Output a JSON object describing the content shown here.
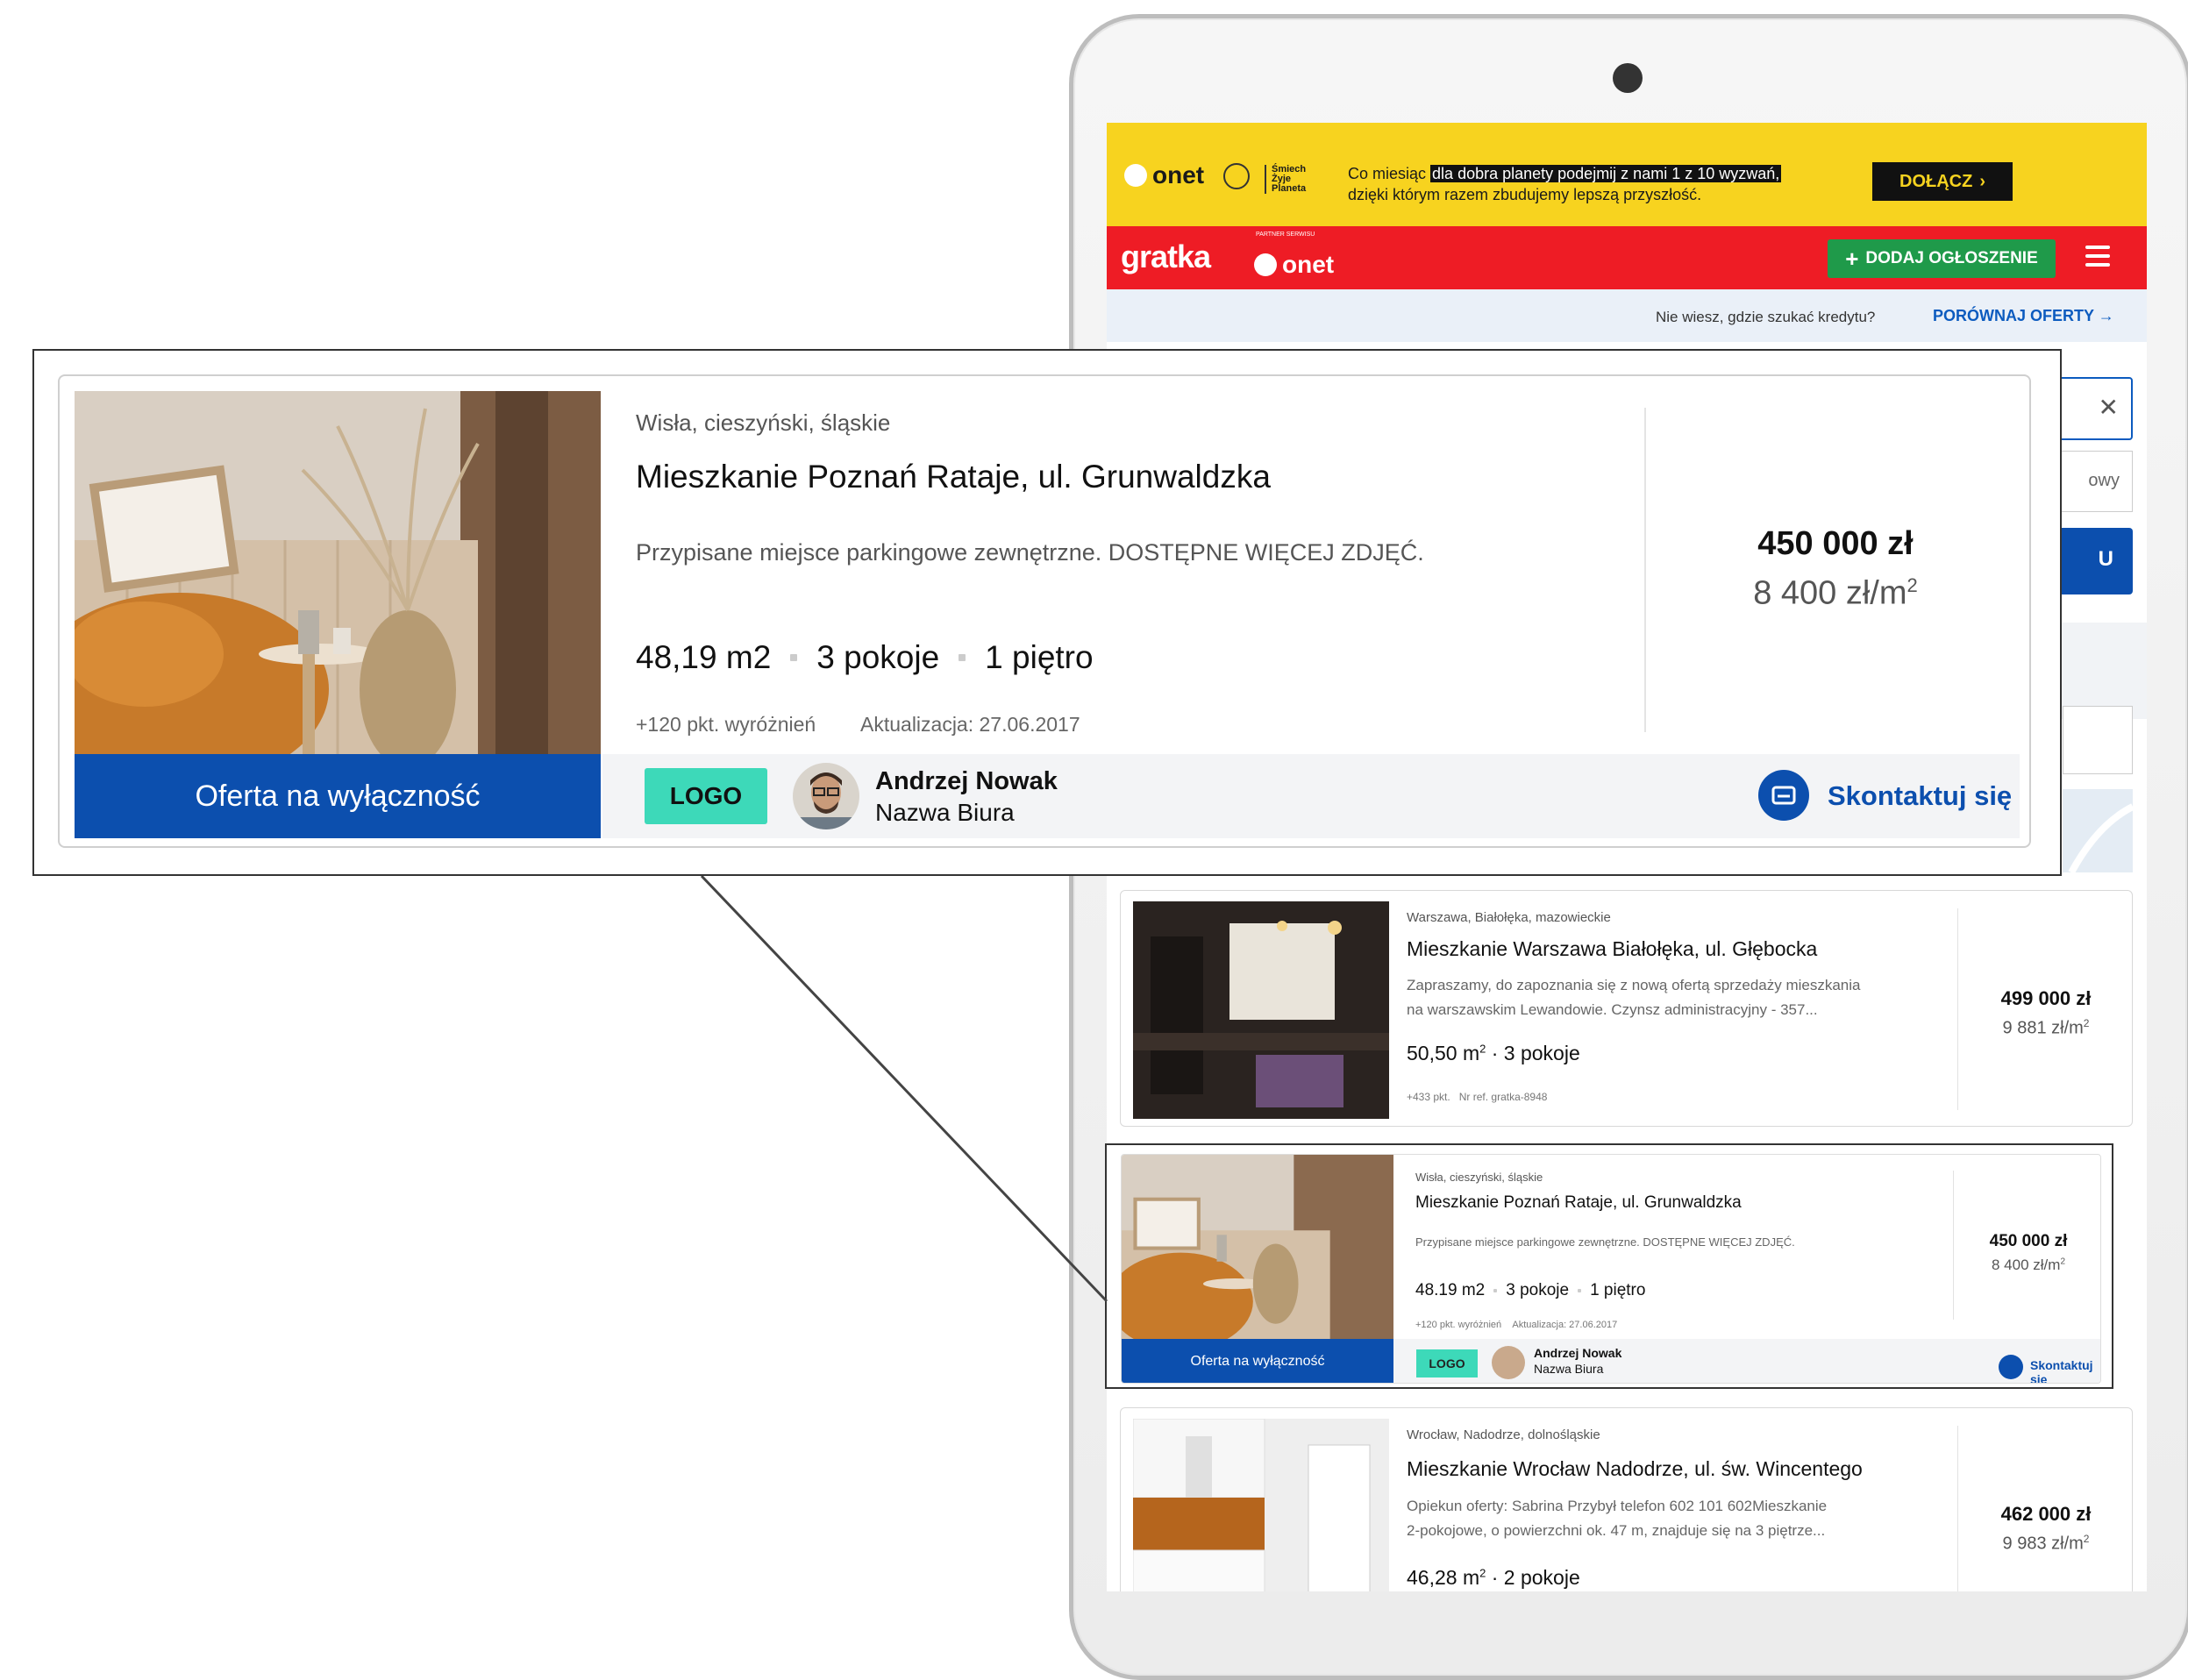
{
  "promo": {
    "brand": "onet",
    "campaign_logo": "Śmiech Żyje Planeta",
    "text_prefix": "Co miesiąc",
    "text_highlight": "dla dobra planety podejmij z nami 1 z 10 wyzwań,",
    "text_suffix": "dzięki którym razem zbudujemy lepszą przyszłość.",
    "cta": "DOŁĄCZ",
    "cta_icon": "chevron-right-icon"
  },
  "nav": {
    "logo": "gratka",
    "partner_caption": "PARTNER SERWISU",
    "partner_brand": "onet",
    "add_button": "DODAJ OGŁOSZENIE",
    "add_icon": "plus-icon",
    "menu_icon": "hamburger-icon"
  },
  "credit": {
    "question": "Nie wiesz, gdzie szukać kredytu?",
    "compare_link": "PORÓWNAJ OFERTY",
    "link_icon": "arrow-right-icon"
  },
  "search": {
    "clear_icon": "close-icon",
    "select_partial": "owy",
    "button_partial": "U"
  },
  "listings": [
    {
      "location": "Warszawa, Białołęka, mazowieckie",
      "title": "Mieszkanie Warszawa Białołęka, ul. Głębocka",
      "desc1": "Zapraszamy, do zapoznania się z nową ofertą sprzedaży mieszkania",
      "desc2": "na warszawskim Lewandowie. Czynsz administracyjny - 357...",
      "area": "50,50 m",
      "rooms": "3 pokoje",
      "points": "+433 pkt.",
      "ref": "Nr ref. gratka-8948",
      "price": "499 000 zł",
      "price_per_m": "9 881 zł/m"
    },
    {
      "location": "Wrocław, Nadodrze, dolnośląskie",
      "title": "Mieszkanie Wrocław Nadodrze, ul. św. Wincentego",
      "desc1": "Opiekun oferty: Sabrina Przybył telefon 602 101 602Mieszkanie",
      "desc2": "2-pokojowe, o powierzchni ok. 47 m, znajduje się na 3 piętrze...",
      "area": "46,28 m",
      "rooms": "2 pokoje",
      "price": "462 000 zł",
      "price_per_m": "9 983 zł/m"
    }
  ],
  "featured_small": {
    "location": "Wisła, cieszyński, śląskie",
    "title": "Mieszkanie Poznań Rataje, ul. Grunwaldzka",
    "desc": "Przypisane miejsce parkingowe zewnętrzne. DOSTĘPNE WIĘCEJ ZDJĘĆ.",
    "area": "48.19 m2",
    "rooms": "3 pokoje",
    "floor": "1 piętro",
    "points": "+120 pkt. wyróżnień",
    "updated": "Aktualizacja: 27.06.2017",
    "price": "450 000 zł",
    "price_per_m": "8 400 zł/m",
    "exclusive": "Oferta na wyłączność",
    "logo": "LOGO",
    "agent": "Andrzej Nowak",
    "office": "Nazwa Biura",
    "contact": "Skontaktuj się"
  },
  "featured_zoom": {
    "location": "Wisła, cieszyński, śląskie",
    "title": "Mieszkanie Poznań Rataje, ul. Grunwaldzka",
    "desc": "Przypisane miejsce parkingowe zewnętrzne. DOSTĘPNE WIĘCEJ ZDJĘĆ.",
    "area": "48,19 m2",
    "rooms": "3 pokoje",
    "floor": "1 piętro",
    "points": "+120 pkt. wyróżnień",
    "updated": "Aktualizacja: 27.06.2017",
    "price": "450 000 zł",
    "price_per_m": "8 400 zł/m",
    "sup": "2",
    "exclusive": "Oferta na wyłączność",
    "logo": "LOGO",
    "agent": "Andrzej Nowak",
    "office": "Nazwa Biura",
    "contact": "Skontaktuj się",
    "contact_icon": "mail-icon"
  },
  "colors": {
    "promo_yellow": "#f7d31f",
    "nav_red": "#ee1c25",
    "add_green": "#1f9a4a",
    "brand_blue": "#0c4fae",
    "logo_teal": "#3dd9b9"
  }
}
